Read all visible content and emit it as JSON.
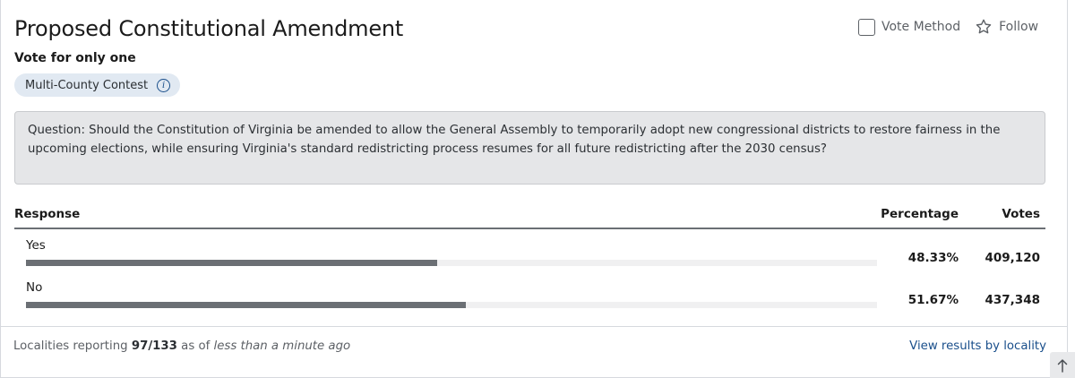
{
  "contest": {
    "title": "Proposed Constitutional Amendment",
    "subtitle": "Vote for only one",
    "badge": "Multi-County Contest",
    "question": "Question: Should the Constitution of Virginia be amended to allow the General Assembly to temporarily adopt new congressional districts to restore fairness in the upcoming elections, while ensuring Virginia's standard redistricting process resumes for all future redistricting after the 2030 census?"
  },
  "actions": {
    "vote_method": "Vote Method",
    "follow": "Follow"
  },
  "table": {
    "headers": {
      "response": "Response",
      "percentage": "Percentage",
      "votes": "Votes"
    },
    "rows": [
      {
        "response": "Yes",
        "percentage": "48.33%",
        "votes": "409,120",
        "bar_fraction": 0.4833
      },
      {
        "response": "No",
        "percentage": "51.67%",
        "votes": "437,348",
        "bar_fraction": 0.5167
      }
    ]
  },
  "footer": {
    "prefix": "Localities reporting",
    "count": "97/133",
    "as_of": "as of",
    "time": "less than a minute ago",
    "link": "View results by locality"
  },
  "icons": {
    "info": "info-icon",
    "checkbox": "checkbox-icon",
    "follow": "star-icon",
    "scroll_top": "arrow-up-icon"
  },
  "colors": {
    "bar_fill": "#6b6f74",
    "bar_track": "#f0f0f1",
    "link": "#1a4f8b",
    "badge_bg": "#e1e9f2",
    "question_bg": "#e5e6e8"
  }
}
